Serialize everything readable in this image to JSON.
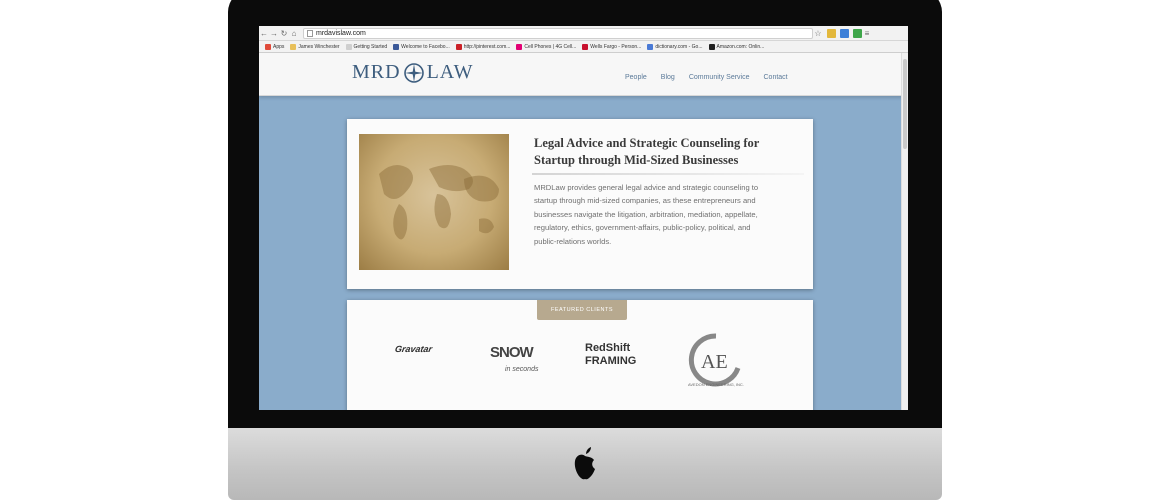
{
  "browser": {
    "url": "mrdavislaw.com",
    "bookmarks": [
      {
        "label": "Apps",
        "color": "#e04a3a"
      },
      {
        "label": "James Winchester",
        "color": "#e8c05a"
      },
      {
        "label": "Getting Started",
        "color": "#cfcfcf"
      },
      {
        "label": "Welcome to Facebo...",
        "color": "#3b5998"
      },
      {
        "label": "http://pinterest.com...",
        "color": "#cb2027"
      },
      {
        "label": "Cell Phones | 4G Cell...",
        "color": "#e20074"
      },
      {
        "label": "Wells Fargo - Person...",
        "color": "#c8102e"
      },
      {
        "label": "dictionary.com - Go...",
        "color": "#4a7ad6"
      },
      {
        "label": "Amazon.com: Onlin...",
        "color": "#222222"
      }
    ]
  },
  "site": {
    "logo_left": "MRD",
    "logo_right": "LAW",
    "nav": [
      "People",
      "Blog",
      "Community Service",
      "Contact"
    ],
    "headline": "Legal Advice and Strategic Counseling for Startup through Mid-Sized Businesses",
    "body": "MRDLaw provides general legal advice and strategic counseling to startup through mid-sized companies, as these entrepreneurs and businesses navigate the litigation, arbitration, mediation, appellate, regulatory, ethics, government-affairs, public-policy, political, and public-relations worlds.",
    "featured_label": "FEATURED CLIENTS",
    "clients": {
      "c1": "Gravatar",
      "c2": "SNOW",
      "c2_sub": "in seconds",
      "c3_top": "RedShift",
      "c3_bottom": "FRAMING",
      "c4": "AVEDON ENGINEERING, INC."
    }
  },
  "colors": {
    "screen_bg": "#8aaccb",
    "logo": "#3d5d7e",
    "nav": "#5b7a99",
    "tag": "#b7a98f"
  }
}
